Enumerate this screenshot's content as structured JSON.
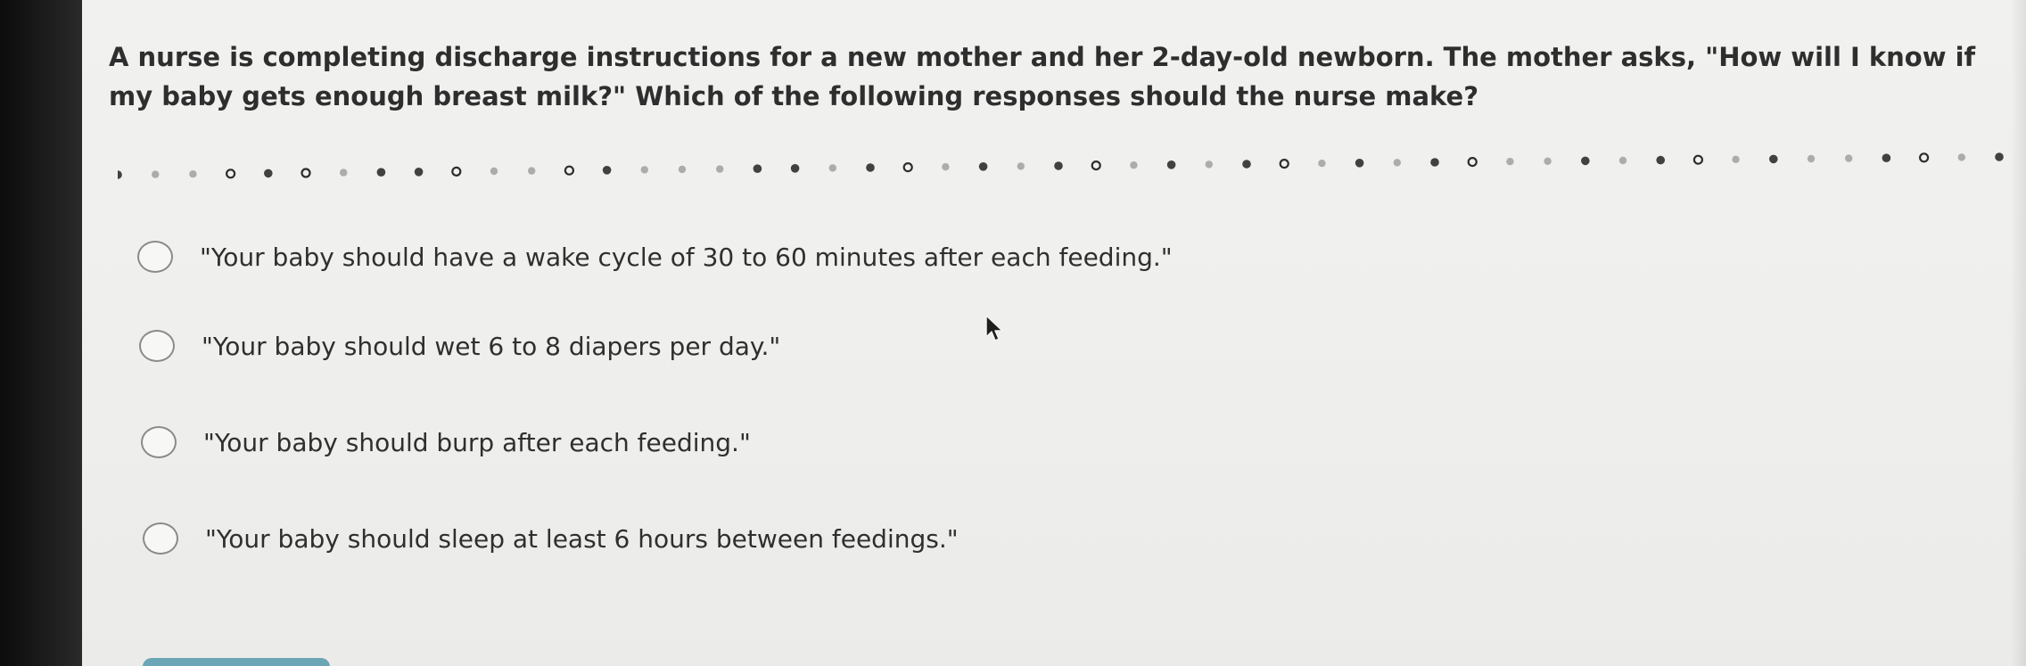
{
  "question": {
    "text": "A nurse is completing discharge instructions for a new mother and her 2-day-old newborn. The mother asks, \"How will I know if my baby gets enough breast milk?\" Which of the following responses should the nurse make?"
  },
  "divider": {
    "color": "#2d2d2d"
  },
  "options": [
    {
      "label": "\"Your baby should have a wake cycle of 30 to 60 minutes after each feeding.\"",
      "selected": false
    },
    {
      "label": "\"Your baby should wet 6 to 8 diapers per day.\"",
      "selected": false
    },
    {
      "label": "\"Your baby should burp after each feeding.\"",
      "selected": false
    },
    {
      "label": "\"Your baby should sleep at least 6 hours between feedings.\"",
      "selected": false
    }
  ],
  "colors": {
    "background": "#efefed",
    "text": "#2e2e2e",
    "accent": "#6aa6b6"
  }
}
